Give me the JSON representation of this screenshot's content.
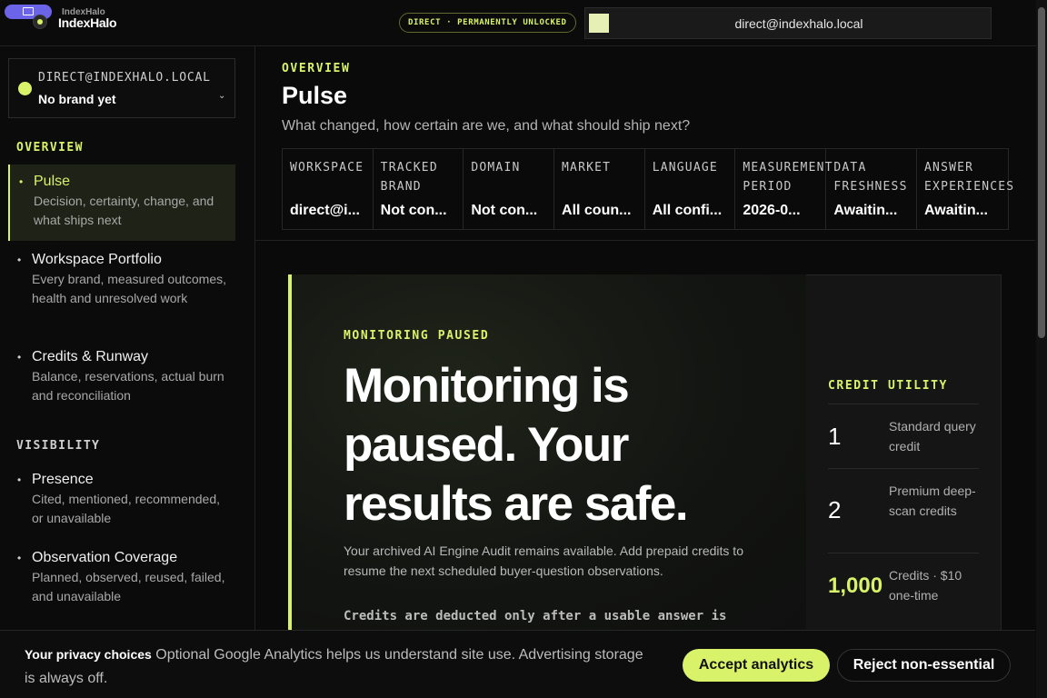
{
  "header": {
    "brand_small": "IndexHalo",
    "brand_name": "IndexHalo",
    "plan_badge": "DIRECT · PERMANENTLY UNLOCKED",
    "account_email": "direct@indexhalo.local"
  },
  "sidebar": {
    "workspace_email": "DIRECT@INDEXHALO.LOCAL",
    "workspace_brand": "No brand yet",
    "sections": [
      {
        "title": "OVERVIEW",
        "items": [
          {
            "label": "Pulse",
            "desc": "Decision, certainty, change, and what ships next"
          },
          {
            "label": "Workspace Portfolio",
            "desc": "Every brand, measured outcomes, health and unresolved work"
          },
          {
            "label": "Credits & Runway",
            "desc": "Balance, reservations, actual burn and reconciliation"
          }
        ]
      },
      {
        "title": "VISIBILITY",
        "items": [
          {
            "label": "Presence",
            "desc": "Cited, mentioned, recommended, or unavailable"
          },
          {
            "label": "Observation Coverage",
            "desc": "Planned, observed, reused, failed, and unavailable"
          }
        ]
      }
    ]
  },
  "main": {
    "eyebrow": "OVERVIEW",
    "title": "Pulse",
    "subtitle": "What changed, how certain are we, and what should ship next?",
    "context": [
      {
        "key": "WORKSPACE",
        "value": "direct@i..."
      },
      {
        "key": "TRACKED\nBRAND",
        "value": "Not con..."
      },
      {
        "key": "DOMAIN",
        "value": "Not con..."
      },
      {
        "key": "MARKET",
        "value": "All coun..."
      },
      {
        "key": "LANGUAGE",
        "value": "All confi..."
      },
      {
        "key": "MEASUREMENT\nPERIOD",
        "value": "2026-0..."
      },
      {
        "key": "DATA\nFRESHNESS",
        "value": "Awaitin..."
      },
      {
        "key": "ANSWER\nEXPERIENCES",
        "value": "Awaitin..."
      }
    ],
    "hero": {
      "eyebrow": "MONITORING PAUSED",
      "headline": "Monitoring is paused. Your results are safe.",
      "body": "Your archived AI Engine Audit remains available. Add prepaid credits to resume the next scheduled buyer-question observations.",
      "note": "Credits are deducted only after a usable answer is"
    },
    "credit_utility": {
      "title": "CREDIT UTILITY",
      "rows": [
        {
          "num": "1",
          "text": "Standard query credit"
        },
        {
          "num": "2",
          "text": "Premium deep-scan credits"
        },
        {
          "num": "1,000",
          "text": "Credits · $10 one-time"
        }
      ]
    }
  },
  "consent": {
    "title": "Your privacy choices",
    "text": "Optional Google Analytics helps us understand site use. Advertising storage is always off.",
    "accept": "Accept analytics",
    "reject": "Reject non-essential"
  },
  "colors": {
    "accent": "#d8f26a",
    "background": "#0a0a0a"
  }
}
